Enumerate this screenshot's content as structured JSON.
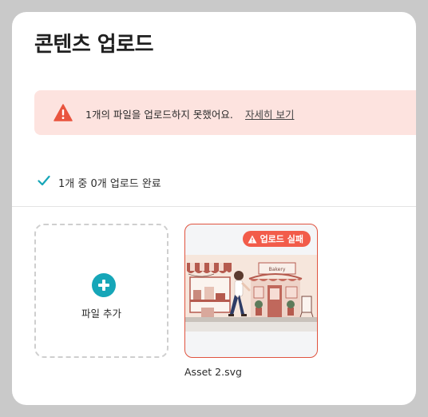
{
  "dialog": {
    "title": "콘텐츠 업로드"
  },
  "alert": {
    "message": "1개의 파일을 업로드하지 못했어요.",
    "link_label": "자세히 보기",
    "icon": "warning-icon",
    "color": "#e9553f"
  },
  "status": {
    "text": "1개 중 0개 업로드 완료",
    "icon": "check-icon",
    "color": "#16a6b8"
  },
  "uploader": {
    "add_label": "파일 추가",
    "add_icon": "plus-circle-icon",
    "files": [
      {
        "name": "Asset 2.svg",
        "status_badge": "업로드 실패",
        "thumbnail_sign": "Bakery"
      }
    ]
  }
}
